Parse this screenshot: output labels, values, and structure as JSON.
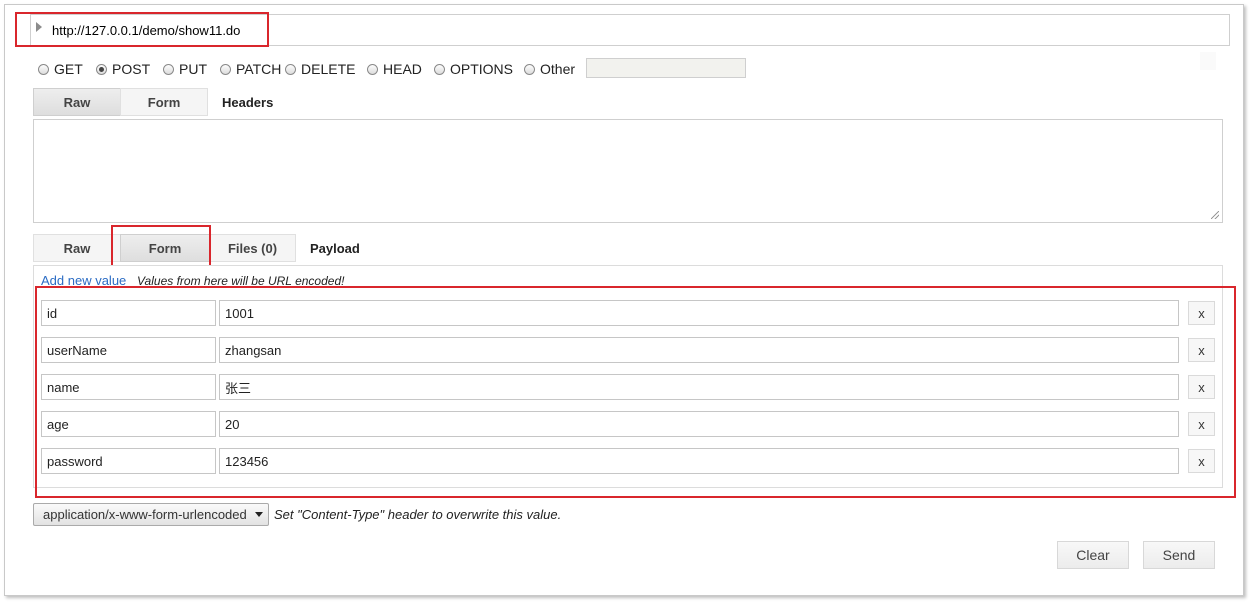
{
  "url": "http://127.0.0.1/demo/show11.do",
  "methods": [
    {
      "label": "GET",
      "checked": false
    },
    {
      "label": "POST",
      "checked": true
    },
    {
      "label": "PUT",
      "checked": false
    },
    {
      "label": "PATCH",
      "checked": false
    },
    {
      "label": "DELETE",
      "checked": false
    },
    {
      "label": "HEAD",
      "checked": false
    },
    {
      "label": "OPTIONS",
      "checked": false
    },
    {
      "label": "Other",
      "checked": false
    }
  ],
  "headers_section": {
    "tabs": [
      "Raw",
      "Form"
    ],
    "active_tab": "Raw",
    "label": "Headers"
  },
  "payload_section": {
    "tabs": [
      "Raw",
      "Form",
      "Files (0)"
    ],
    "active_tab": "Form",
    "label": "Payload",
    "add_new_value": "Add new value",
    "url_encoded_note": "Values from here will be URL encoded!",
    "rows": [
      {
        "key": "id",
        "value": "1001"
      },
      {
        "key": "userName",
        "value": "zhangsan"
      },
      {
        "key": "name",
        "value": "张三"
      },
      {
        "key": "age",
        "value": "20"
      },
      {
        "key": "password",
        "value": "123456"
      }
    ],
    "remove_label": "x"
  },
  "content_type": {
    "selected": "application/x-www-form-urlencoded",
    "note": "Set \"Content-Type\" header to overwrite this value."
  },
  "buttons": {
    "clear": "Clear",
    "send": "Send"
  },
  "colors": {
    "highlight": "#d9262c",
    "link": "#2b6cc4"
  }
}
